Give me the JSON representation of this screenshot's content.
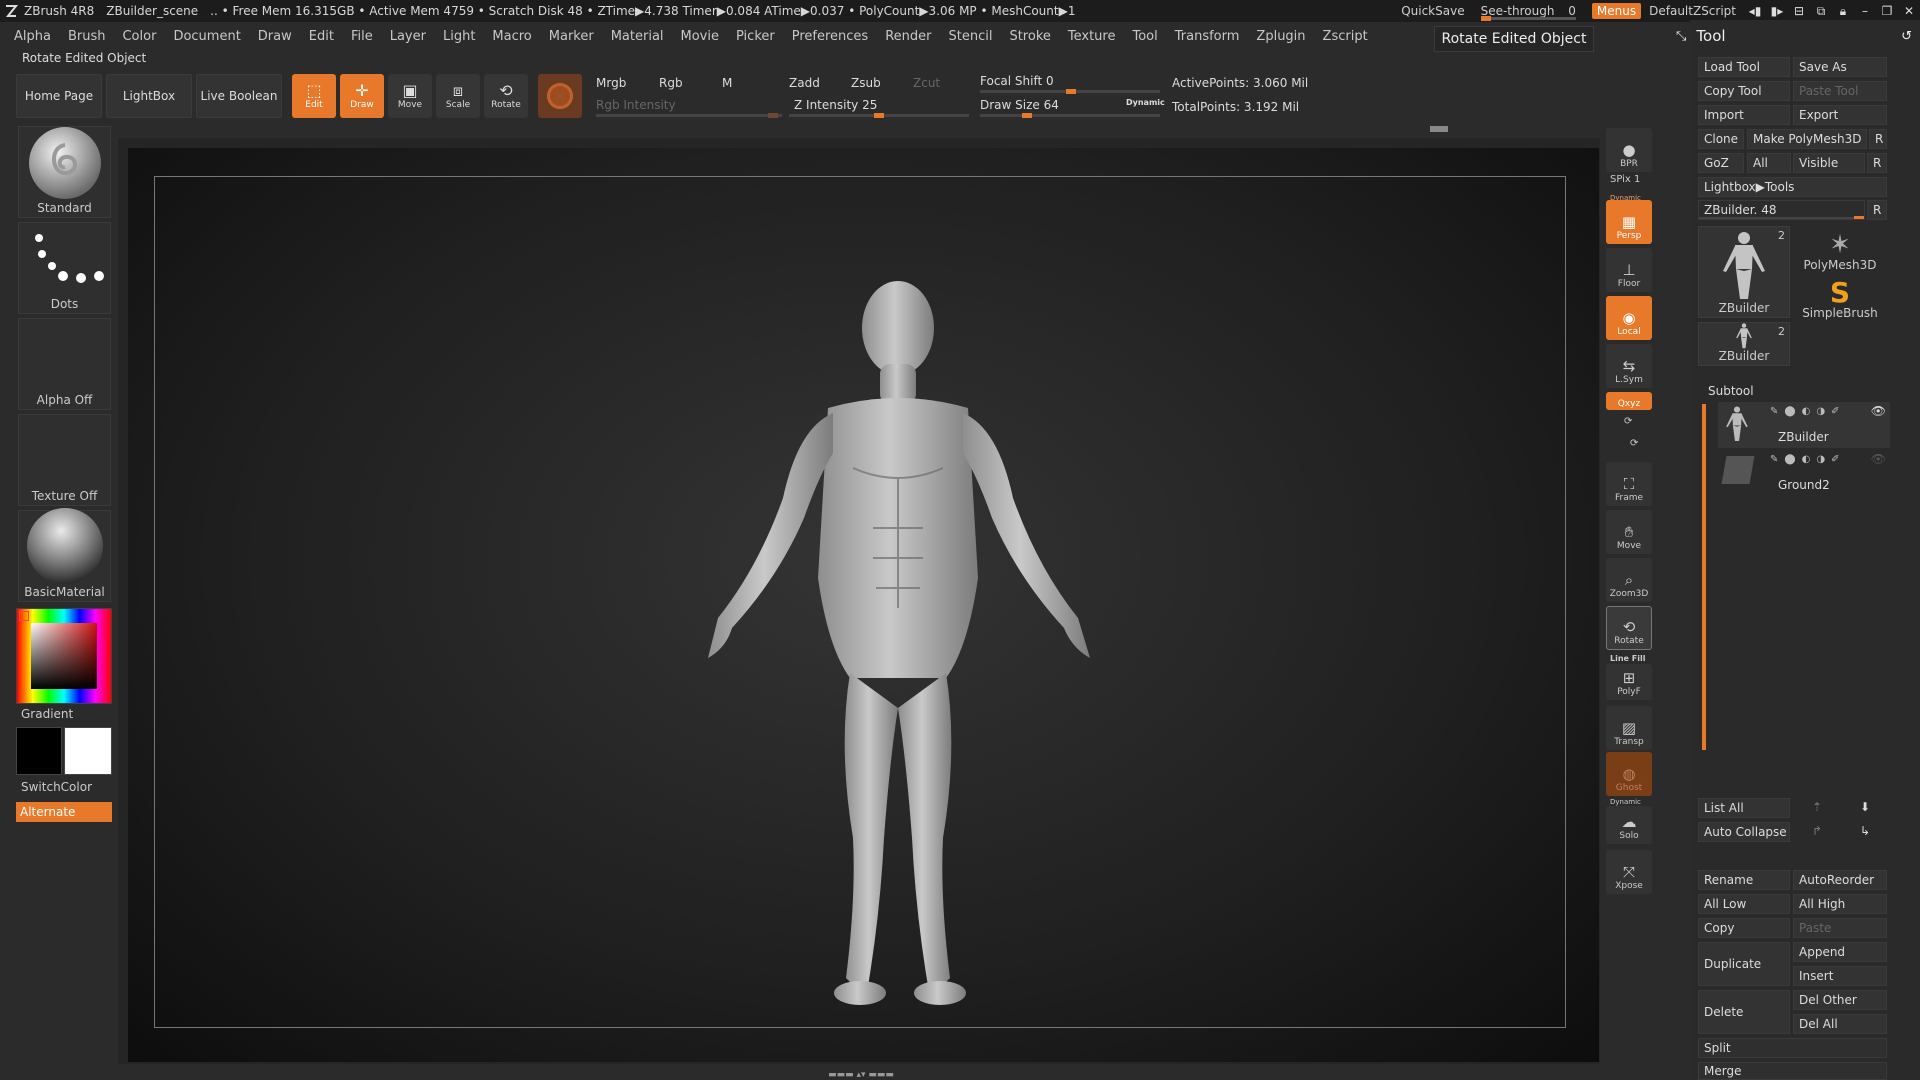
{
  "titlebar": {
    "app": "ZBrush 4R8",
    "scene": "ZBuilder_scene",
    "stats": ".. • Free Mem 16.315GB • Active Mem 4759 • Scratch Disk 48 • ZTime▶4.738 Timer▶0.084 ATime▶0.037 • PolyCount▶3.06 MP • MeshCount▶1",
    "quicksave": "QuickSave",
    "seethrough_label": "See-through",
    "seethrough_value": "0",
    "seethrough_level": 0,
    "menus": "Menus",
    "script": "DefaultZScript"
  },
  "menubar": [
    "Alpha",
    "Brush",
    "Color",
    "Document",
    "Draw",
    "Edit",
    "File",
    "Layer",
    "Light",
    "Macro",
    "Marker",
    "Material",
    "Movie",
    "Picker",
    "Preferences",
    "Render",
    "Stencil",
    "Stroke",
    "Texture",
    "Tool",
    "Transform",
    "Zplugin",
    "Zscript"
  ],
  "status_text": "Rotate Edited Object",
  "tooltip": "Rotate Edited Object",
  "toolbar": {
    "home": "Home Page",
    "lightbox": "LightBox",
    "live_boolean": "Live Boolean",
    "edit": "Edit",
    "draw": "Draw",
    "move": "Move",
    "scale": "Scale",
    "rotate": "Rotate",
    "mrgb": "Mrgb",
    "rgb": "Rgb",
    "m": "M",
    "rgb_intensity": "Rgb Intensity",
    "zadd": "Zadd",
    "zsub": "Zsub",
    "zcut": "Zcut",
    "z_intensity": "Z Intensity 25",
    "z_intensity_level": 0.25,
    "focal_shift": "Focal Shift 0",
    "draw_size": "Draw Size 64",
    "dynamic": "Dynamic",
    "active_points": "ActivePoints: 3.060 Mil",
    "total_points": "TotalPoints: 3.192 Mil"
  },
  "left_shelf": {
    "brush": "Standard",
    "stroke": "Dots",
    "alpha": "Alpha Off",
    "texture": "Texture Off",
    "material": "BasicMaterial",
    "gradient": "Gradient",
    "switch_color": "SwitchColor",
    "alternate": "Alternate"
  },
  "right_shelf": {
    "bpr": "BPR",
    "spix": "SPix 1",
    "dynamic": "Dynamic",
    "persp": "Persp",
    "floor": "Floor",
    "local": "Local",
    "lsym": "L.Sym",
    "xyz": "Qxyz",
    "frame": "Frame",
    "move": "Move",
    "zoom3d": "Zoom3D",
    "rotate": "Rotate",
    "line_fill": "Line Fill",
    "polyf": "PolyF",
    "transp": "Transp",
    "ghost": "Ghost",
    "dynamic2": "Dynamic",
    "solo": "Solo",
    "xpose": "Xpose"
  },
  "tool_panel": {
    "title": "Tool",
    "load_tool": "Load Tool",
    "save_as": "Save As",
    "copy_tool": "Copy Tool",
    "paste_tool": "Paste Tool",
    "import": "Import",
    "export": "Export",
    "clone": "Clone",
    "make_polymesh": "Make PolyMesh3D",
    "goz": "GoZ",
    "all": "All",
    "visible": "Visible",
    "r": "R",
    "lightbox_tools": "Lightbox▶Tools",
    "zbuilder_slider": "ZBuilder. 48",
    "thumbs": [
      {
        "name": "ZBuilder",
        "count": "2"
      },
      {
        "name": "PolyMesh3D",
        "count": ""
      },
      {
        "name": "SimpleBrush",
        "count": ""
      },
      {
        "name": "ZBuilder",
        "count": "2"
      }
    ],
    "subtool_title": "Subtool",
    "subtools": [
      "ZBuilder",
      "Ground2"
    ],
    "list_all": "List All",
    "auto_collapse": "Auto Collapse",
    "rename": "Rename",
    "autoreorder": "AutoReorder",
    "all_low": "All Low",
    "all_high": "All High",
    "copy": "Copy",
    "paste": "Paste",
    "duplicate": "Duplicate",
    "append": "Append",
    "insert": "Insert",
    "delete": "Delete",
    "del_other": "Del Other",
    "del_all": "Del All",
    "split": "Split",
    "merge": "Merge"
  }
}
